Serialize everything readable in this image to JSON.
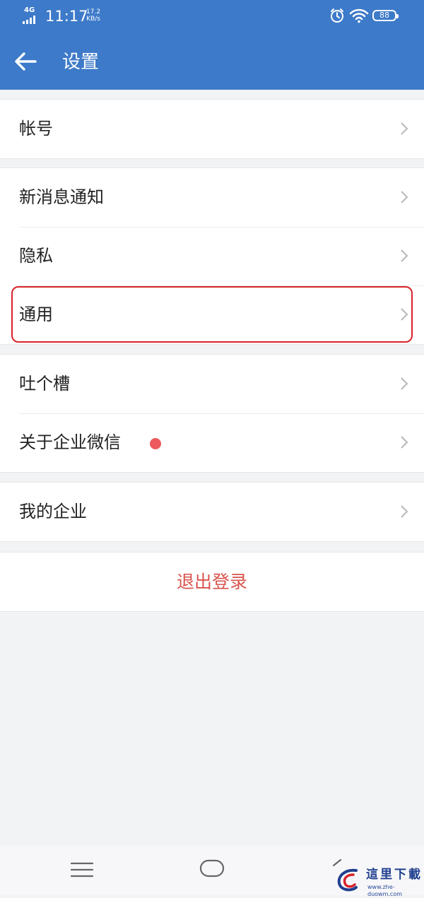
{
  "status_bar": {
    "network": "4G",
    "time": "11:17",
    "speed_value": "17.2",
    "speed_unit": "KB/s",
    "battery": "88",
    "icons": [
      "signal-icon",
      "alarm-icon",
      "wifi-icon",
      "battery-icon"
    ]
  },
  "header": {
    "title": "设置",
    "back_icon": "arrow-left-icon",
    "background": "#3d7ac9"
  },
  "groups": [
    {
      "items": [
        {
          "label": "帐号"
        }
      ]
    },
    {
      "items": [
        {
          "label": "新消息通知"
        },
        {
          "label": "隐私"
        },
        {
          "label": "通用"
        }
      ]
    },
    {
      "items": [
        {
          "label": "吐个槽"
        },
        {
          "label": "关于企业微信",
          "badge": "red-dot"
        }
      ]
    },
    {
      "items": [
        {
          "label": "我的企业"
        }
      ]
    }
  ],
  "highlighted_item": "通用",
  "logout": {
    "label": "退出登录",
    "color": "#d9544d"
  },
  "nav_bar": {
    "icons": [
      "menu-icon",
      "home-icon",
      "back-icon"
    ]
  },
  "watermark": {
    "name": "這里下載",
    "url": "www.zhe-duowm.com"
  },
  "colors": {
    "accent": "#3d7ac9",
    "highlight_border": "#d8232a",
    "badge_dot": "#ec5a5e",
    "page_background": "#f2f3f5"
  }
}
